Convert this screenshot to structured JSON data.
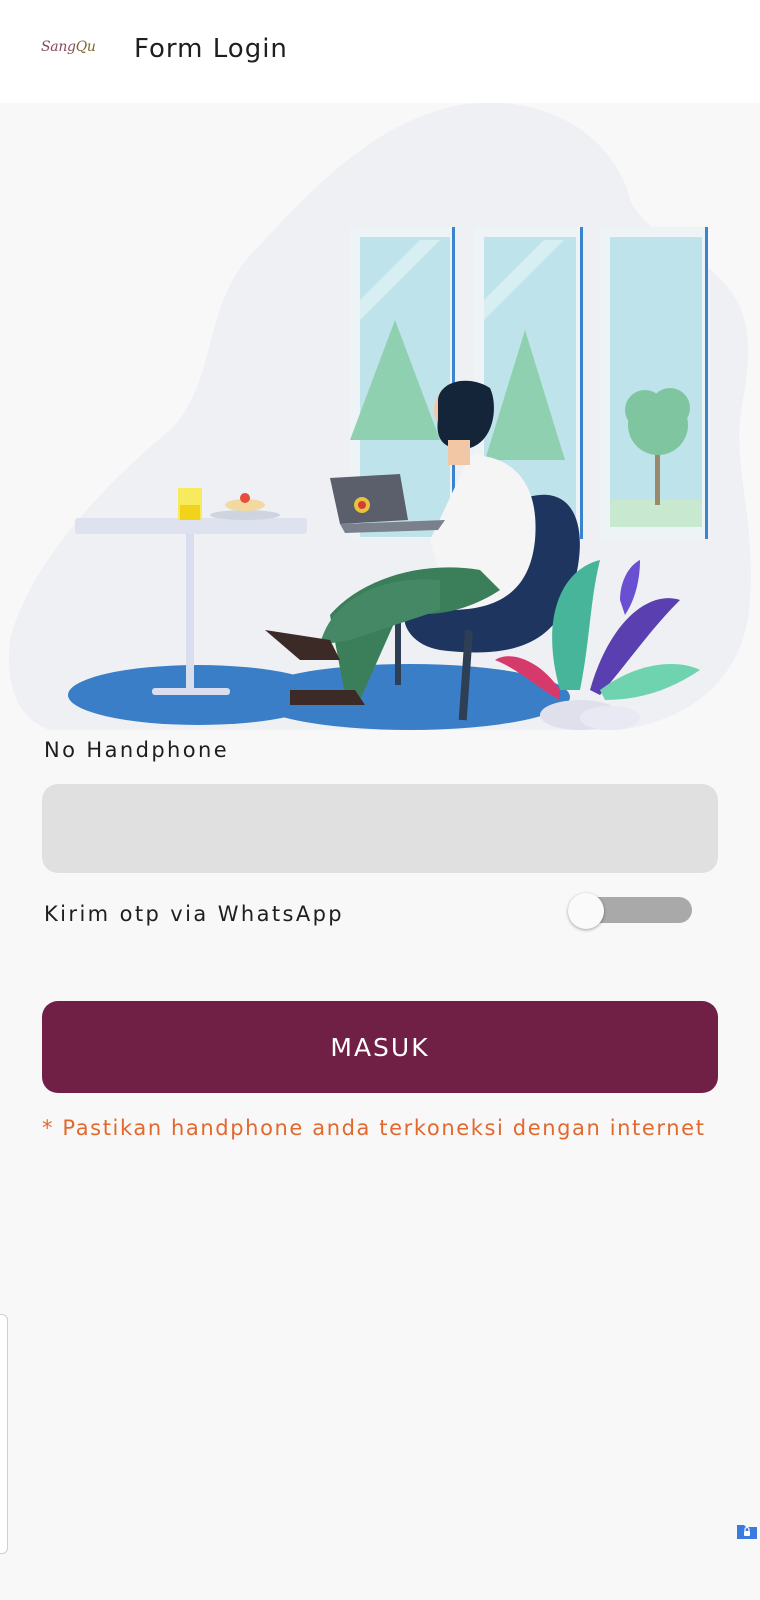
{
  "header": {
    "logo_text": "Sang",
    "logo_text_accent": "Qu",
    "title": "Form Login"
  },
  "form": {
    "phone_label": "No Handphone",
    "phone_value": "",
    "whatsapp_label": "Kirim otp via WhatsApp",
    "whatsapp_toggle_on": false,
    "submit_label": "MASUK",
    "note": "* Pastikan handphone anda terkoneksi dengan internet"
  },
  "colors": {
    "primary": "#701f45",
    "note": "#e4682c",
    "input_bg": "#e0e0e0",
    "toggle_track_off": "#a9a9a9"
  },
  "icons": {
    "corner_badge": "folder-lock-icon"
  }
}
